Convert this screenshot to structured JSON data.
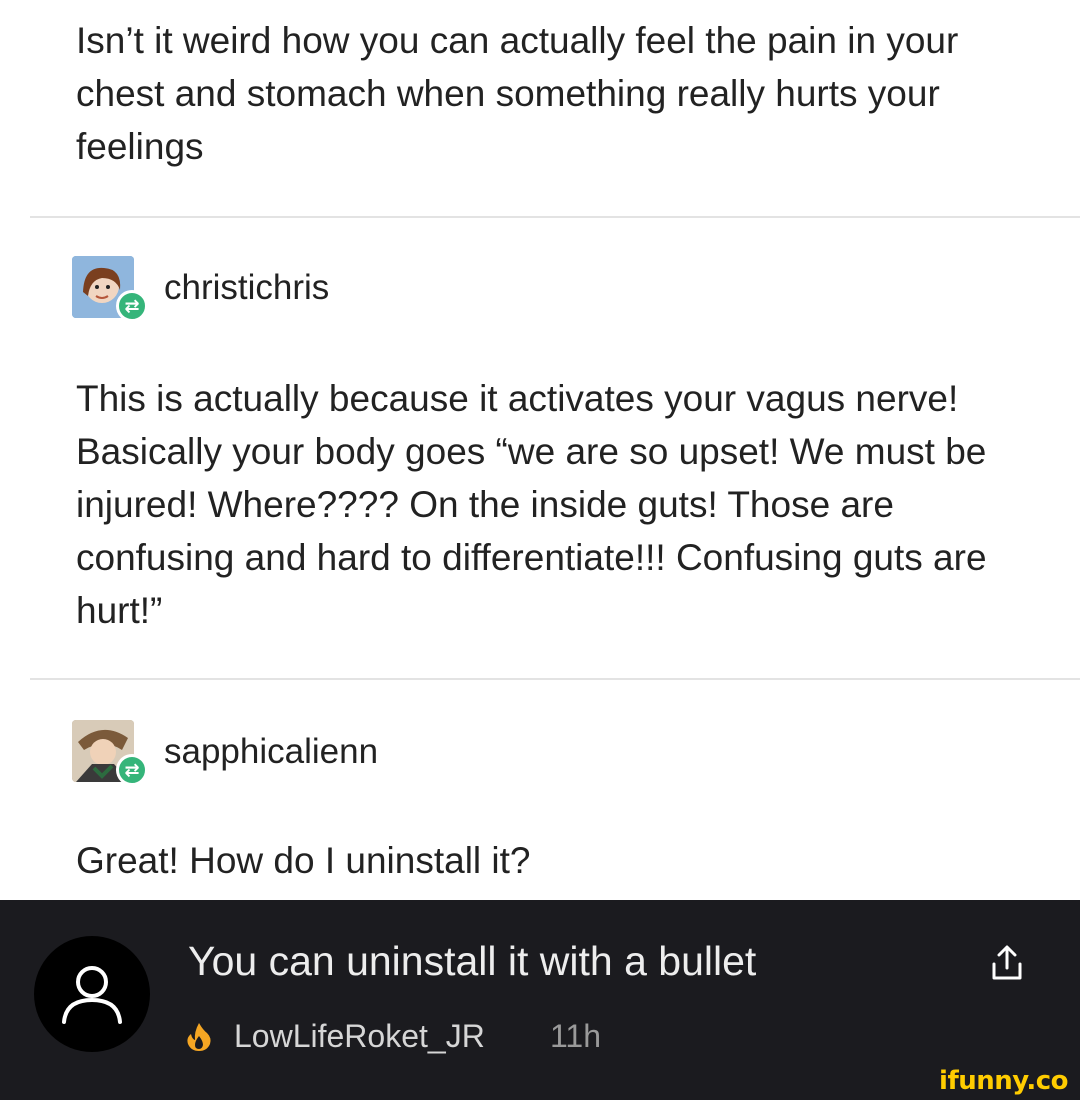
{
  "post": {
    "original_text": "Isn’t it weird how you can actually feel the pain in your chest and stomach when something really hurts your feelings",
    "replies": [
      {
        "username": "christichris",
        "text": "This is actually because it activates your vagus nerve! Basically your body goes “we are so upset! We must be injured! Where???? On the inside guts! Those are confusing and hard to differentiate!!! Confusing guts are hurt!”"
      },
      {
        "username": "sapphicalienn",
        "text": "Great! How do I uninstall it?"
      }
    ]
  },
  "comment": {
    "text": "You can uninstall it with a bullet",
    "username": "LowLifeRoket_JR",
    "time": "11h"
  },
  "watermark": "ifunny.co",
  "colors": {
    "comment_bg": "#1b1b1f",
    "reblog_green": "#35b57a",
    "fire_orange": "#f5a623",
    "watermark_yellow": "#ffcc00"
  },
  "icons": [
    "reblog-icon",
    "user-avatar-icon",
    "fire-icon",
    "share-icon"
  ]
}
